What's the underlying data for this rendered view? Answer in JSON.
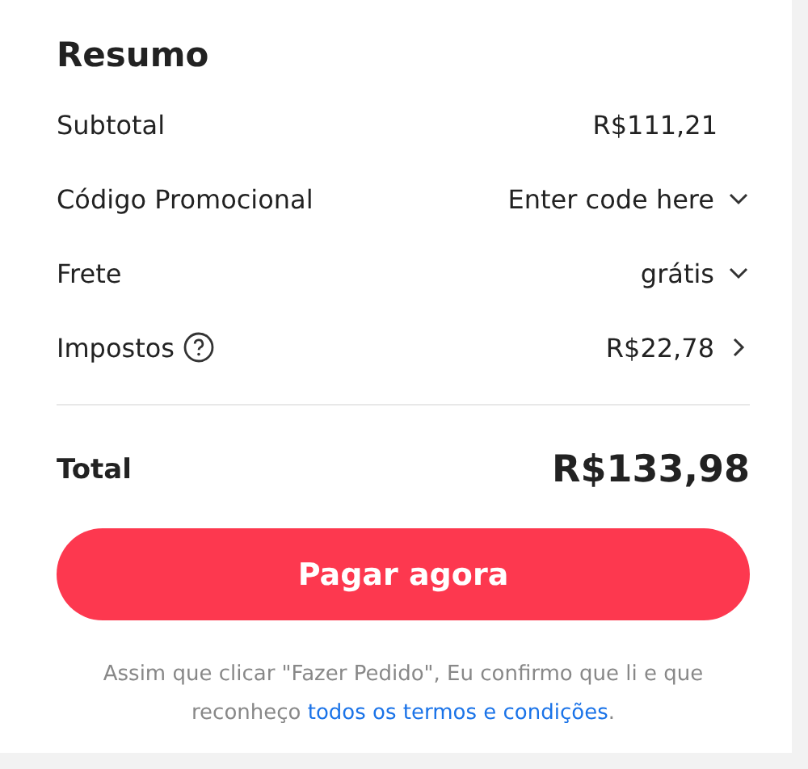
{
  "summary": {
    "title": "Resumo",
    "rows": [
      {
        "label": "Subtotal",
        "value": "R$111,21",
        "kind": "plain"
      },
      {
        "label": "Código Promocional",
        "value": "Enter code here",
        "kind": "dropdown"
      },
      {
        "label": "Frete",
        "value": "grátis",
        "kind": "dropdown"
      },
      {
        "label": "Impostos",
        "value": "R$22,78",
        "kind": "info"
      }
    ],
    "total": {
      "label": "Total",
      "value": "R$133,98"
    },
    "button": "Pagar agora",
    "disclaimer": {
      "text": "Assim que clicar \"Fazer Pedido\", Eu confirmo que li e que reconheço",
      "link": "todos os termos e condições",
      "end": "."
    }
  }
}
